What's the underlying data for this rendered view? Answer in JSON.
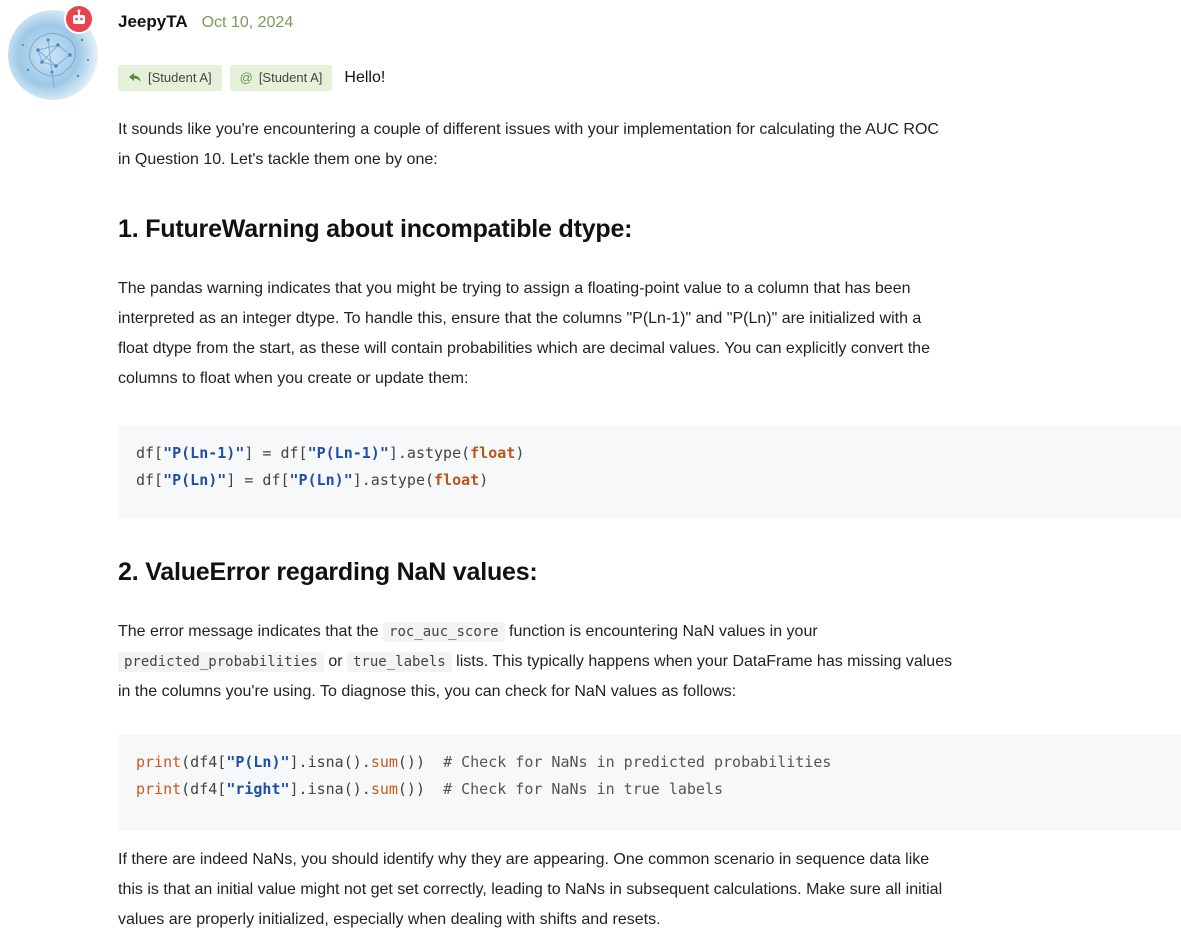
{
  "post": {
    "author": "JeepyTA",
    "date": "Oct 10, 2024",
    "reply_chip": "[Student A]",
    "mention_chip": "[Student A]",
    "greeting": "Hello!",
    "intro_line1": "It sounds like you're encountering a couple of different issues with your implementation for calculating the AUC ROC",
    "intro_line2": "in Question 10. Let's tackle them one by one:"
  },
  "section1": {
    "heading": "1. FutureWarning about incompatible dtype:",
    "lines": [
      "The pandas warning indicates that you might be trying to assign a floating-point value to a column that has been",
      "interpreted as an integer dtype. To handle this, ensure that the columns \"P(Ln-1)\" and \"P(Ln)\" are initialized with a",
      "float dtype from the start, as these will contain probabilities which are decimal values. You can explicitly convert the",
      "columns to float when you create or update them:"
    ],
    "code": {
      "line1_a": "df[",
      "line1_b": "\"P(Ln-1)\"",
      "line1_c": "] = df[",
      "line1_d": "\"P(Ln-1)\"",
      "line1_e": "].astype(",
      "line1_f": "float",
      "line1_g": ")",
      "line2_a": "df[",
      "line2_b": "\"P(Ln)\"",
      "line2_c": "] = df[",
      "line2_d": "\"P(Ln)\"",
      "line2_e": "].astype(",
      "line2_f": "float",
      "line2_g": ")"
    }
  },
  "section2": {
    "heading": "2. ValueError regarding NaN values:",
    "p1_a": "The error message indicates that the ",
    "p1_code": "roc_auc_score",
    "p1_b": " function is encountering NaN values in your",
    "p2_code1": "predicted_probabilities",
    "p2_mid": " or ",
    "p2_code2": "true_labels",
    "p2_b": " lists. This typically happens when your DataFrame has missing values",
    "p3": "in the columns you're using. To diagnose this, you can check for NaN values as follows:",
    "code": {
      "l1_print": "print",
      "l1_a": "(df4[",
      "l1_str": "\"P(Ln)\"",
      "l1_b": "].isna().",
      "l1_sum": "sum",
      "l1_c": "())  ",
      "l1_comment": "# Check for NaNs in predicted probabilities",
      "l2_print": "print",
      "l2_a": "(df4[",
      "l2_str": "\"right\"",
      "l2_b": "].isna().",
      "l2_sum": "sum",
      "l2_c": "())  ",
      "l2_comment": "# Check for NaNs in true labels"
    },
    "closing": [
      "If there are indeed NaNs, you should identify why they are appearing. One common scenario in sequence data like",
      "this is that an initial value might not get set correctly, leading to NaNs in subsequent calculations. Make sure all initial",
      "values are properly initialized, especially when dealing with shifts and resets."
    ]
  },
  "icons": {
    "avatar": "brain-network-avatar",
    "badge": "robot-icon",
    "reply": "reply-arrow-icon",
    "mention": "at-icon"
  },
  "colors": {
    "chip_bg": "#e6f1da",
    "date": "#7c9a5c",
    "badge": "#e8434f",
    "code_bg": "#f6f8fa",
    "code_string": "#1e4fa8",
    "code_keyword": "#b5561b"
  }
}
